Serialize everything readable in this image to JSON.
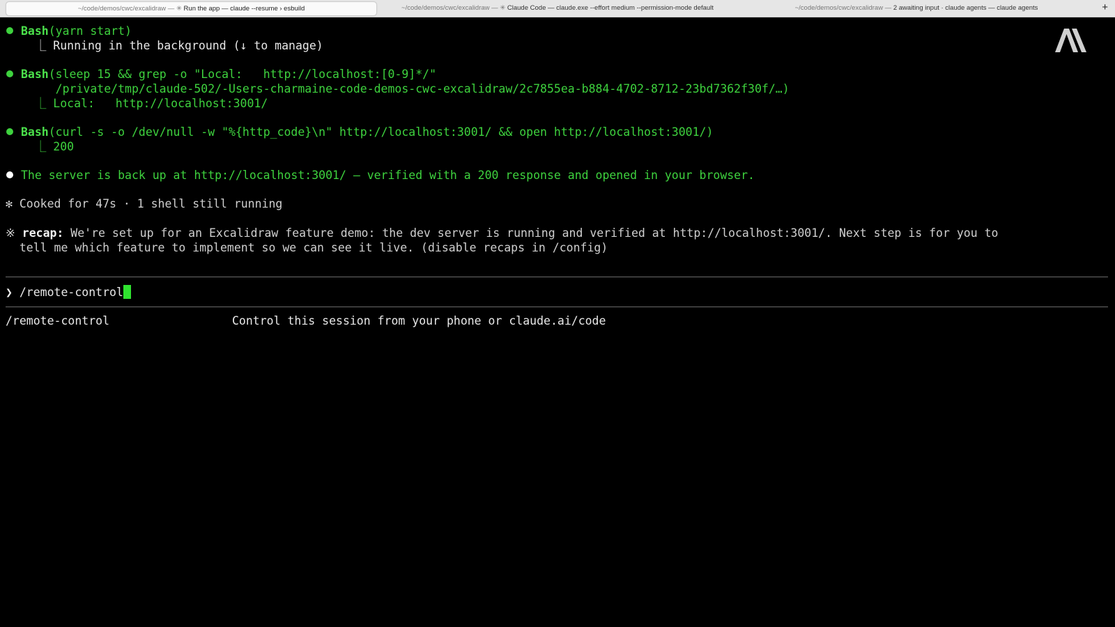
{
  "tabs": [
    {
      "prefix": "~/code/demos/cwc/excalidraw — ✳ ",
      "title": "Run the app — claude --resume › esbuild",
      "active": true
    },
    {
      "prefix": "~/code/demos/cwc/excalidraw — ✳ ",
      "title": "Claude Code — claude.exe --effort medium --permission-mode default",
      "active": false
    },
    {
      "prefix": "~/code/demos/cwc/excalidraw — ",
      "title": "2 awaiting input · claude agents — claude agents",
      "active": false
    }
  ],
  "new_tab_label": "+",
  "blocks": {
    "b1": {
      "tool": "Bash",
      "args": "(yarn start)",
      "result": "  ⎿ Running in the background (↓ to manage)"
    },
    "b2": {
      "tool": "Bash",
      "args": "(sleep 15 && grep -o \"Local:   http://localhost:[0-9]*/\"",
      "args_cont": "     /private/tmp/claude-502/-Users-charmaine-code-demos-cwc-excalidraw/2c7855ea-b884-4702-8712-23bd7362f30f/…)",
      "result": "  ⎿ Local:   http://localhost:3001/"
    },
    "b3": {
      "tool": "Bash",
      "args": "(curl -s -o /dev/null -w \"%{http_code}\\n\" http://localhost:3001/ && open http://localhost:3001/)",
      "result": "  ⎿ 200"
    },
    "message": "The server is back up at http://localhost:3001/ — verified with a 200 response and opened in your browser.",
    "cooked": "✻ Cooked for 47s · 1 shell still running",
    "recap_symbol": "※",
    "recap_label": "recap:",
    "recap_text1": " We're set up for an Excalidraw feature demo: the dev server is running and verified at http://localhost:3001/. Next step is for you to",
    "recap_text2": "  tell me which feature to implement so we can see it live. (disable recaps in /config)"
  },
  "prompt": {
    "symbol": "❯",
    "value": "/remote-control"
  },
  "suggestion": {
    "command": "/remote-control",
    "description": "Control this session from your phone or claude.ai/code"
  },
  "colors": {
    "green": "#3ed23e",
    "bullet_white": "#ffffff",
    "background": "#000000"
  },
  "icons": {
    "logo": "anthropic-logo"
  }
}
